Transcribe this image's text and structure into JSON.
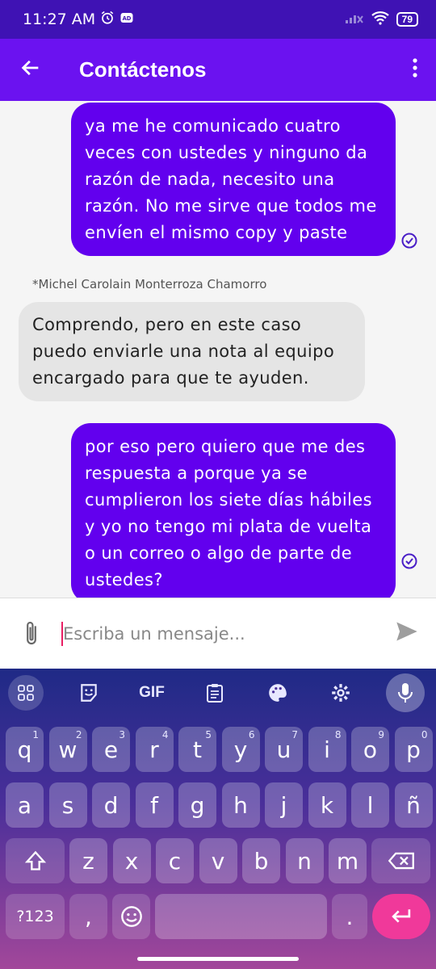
{
  "status_bar": {
    "time": "11:27 AM",
    "battery": "79"
  },
  "app_bar": {
    "title": "Contáctenos"
  },
  "messages": [
    {
      "direction": "outgoing",
      "text": "ya me he comunicado cuatro veces con ustedes y ninguno da razón de nada, necesito una razón. No me sirve que todos me envíen el mismo copy y paste"
    },
    {
      "direction": "incoming",
      "sender": "*Michel Carolain Monterroza Chamorro",
      "text": "Comprendo, pero en este caso puedo enviarle una nota al equipo encargado para que te ayuden."
    },
    {
      "direction": "outgoing",
      "text": "por eso pero quiero que me des respuesta a porque ya se cumplieron los siete días hábiles y yo no tengo mi plata de vuelta o un correo o algo de parte de ustedes?"
    }
  ],
  "composer": {
    "placeholder": "Escriba un mensaje..."
  },
  "keyboard": {
    "toolbar": {
      "gif": "GIF"
    },
    "row1": [
      {
        "k": "q",
        "h": "1"
      },
      {
        "k": "w",
        "h": "2"
      },
      {
        "k": "e",
        "h": "3"
      },
      {
        "k": "r",
        "h": "4"
      },
      {
        "k": "t",
        "h": "5"
      },
      {
        "k": "y",
        "h": "6"
      },
      {
        "k": "u",
        "h": "7"
      },
      {
        "k": "i",
        "h": "8"
      },
      {
        "k": "o",
        "h": "9"
      },
      {
        "k": "p",
        "h": "0"
      }
    ],
    "row2": [
      "a",
      "s",
      "d",
      "f",
      "g",
      "h",
      "j",
      "k",
      "l",
      "ñ"
    ],
    "row3": [
      "z",
      "x",
      "c",
      "v",
      "b",
      "n",
      "m"
    ],
    "row4": {
      "symbols": "?123",
      "comma": ",",
      "period": "."
    }
  }
}
